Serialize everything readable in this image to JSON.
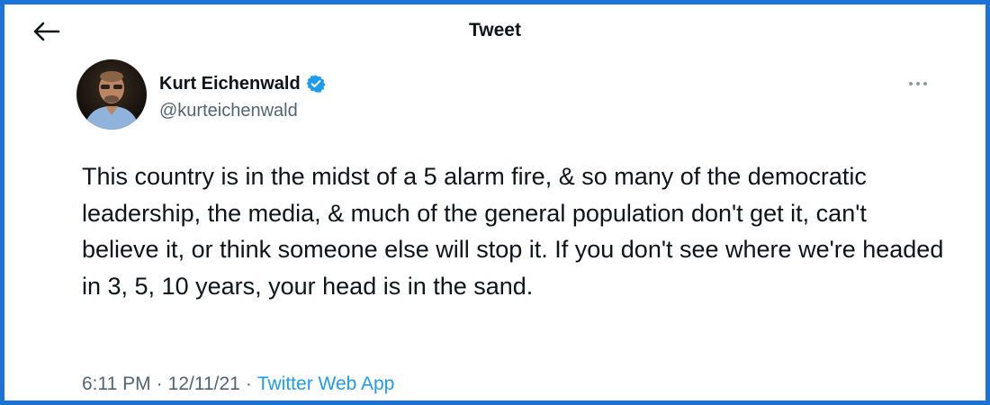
{
  "header": {
    "title": "Tweet",
    "back_icon": "arrow-left-icon"
  },
  "author": {
    "display_name": "Kurt Eichenwald",
    "handle": "@kurteichenwald",
    "verified_icon": "verified-badge-icon",
    "verified_color": "#1d9bf0"
  },
  "more_icon": "more-horizontal-icon",
  "tweet": {
    "text": "This country is in the midst of a 5 alarm fire, & so many of the democratic leadership, the media, & much of the general population don't get it, can't believe it, or think someone else will stop it. If you don't see where we're headed in 3, 5, 10 years, your head is in the sand.",
    "time": "6:11 PM",
    "separator": "·",
    "date": "12/11/21",
    "source": "Twitter Web App"
  },
  "colors": {
    "frame_border": "#1d72d8",
    "text_primary": "#0f1419",
    "text_secondary": "#536471",
    "link": "#1d9bf0"
  }
}
